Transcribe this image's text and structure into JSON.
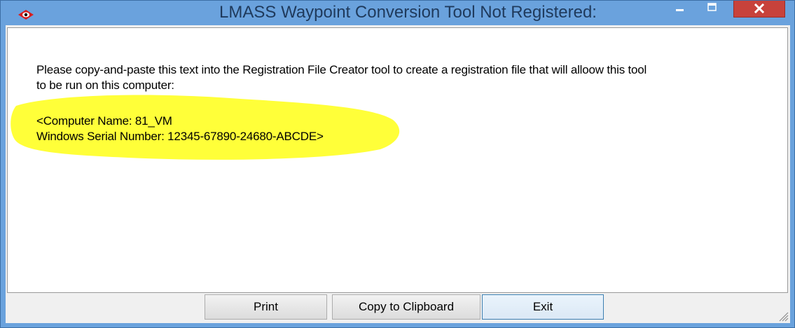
{
  "window": {
    "title": "LMASS Waypoint Conversion Tool Not Registered:"
  },
  "icons": {
    "app": "eye-diamond-icon",
    "minimize": "minimize-icon",
    "maximize": "maximize-icon",
    "close": "close-icon",
    "grip": "resize-grip-icon"
  },
  "message": {
    "line1": "Please copy-and-paste this text into the Registration File Creator tool to create a registration file that will alloow this tool",
    "line2": "to be run on this computer:",
    "line3": "<Computer Name: 81_VM",
    "line4": "Windows Serial Number: 12345-67890-24680-ABCDE>"
  },
  "buttons": {
    "print": "Print",
    "copy": "Copy to Clipboard",
    "exit": "Exit"
  },
  "colors": {
    "titlebar": "#6aa2dd",
    "close_button": "#c8423b",
    "highlight": "#ffff2e"
  }
}
